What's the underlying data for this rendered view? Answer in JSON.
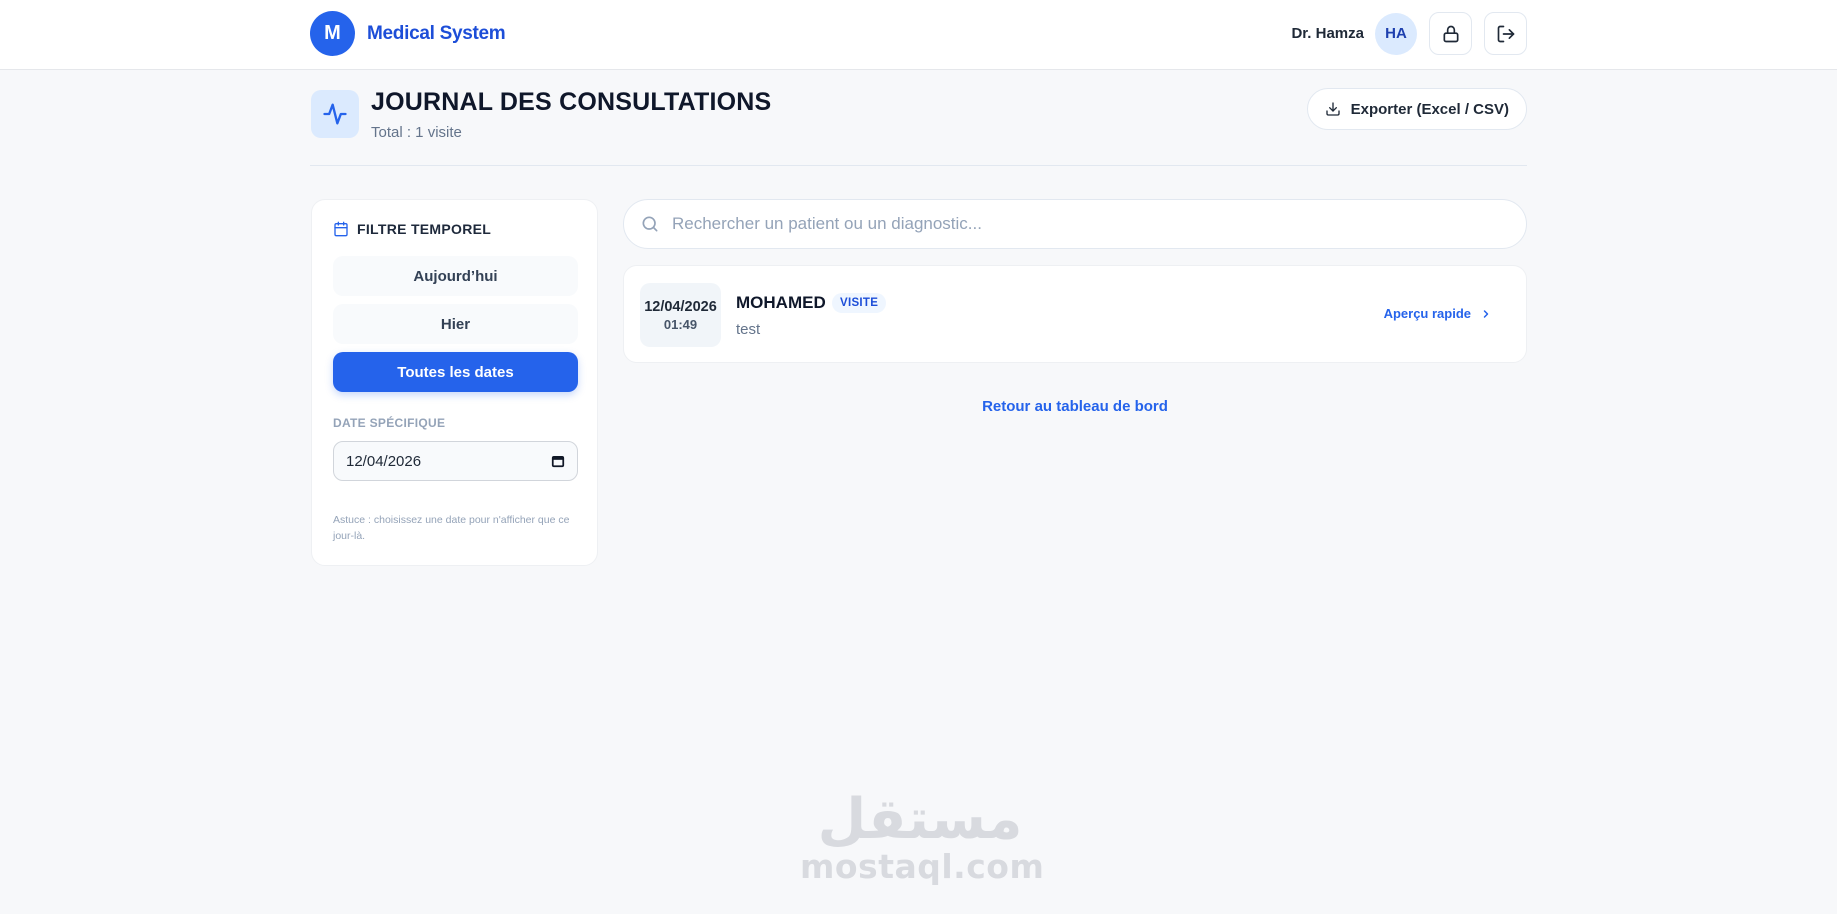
{
  "brand": {
    "logo_letter": "M",
    "name": "Medical System"
  },
  "user": {
    "name": "Dr. Hamza",
    "initials": "HA"
  },
  "header": {
    "title": "JOURNAL DES CONSULTATIONS",
    "subtitle": "Total : 1 visite",
    "export_label": "Exporter (Excel / CSV)"
  },
  "filter": {
    "title": "FILTRE TEMPOREL",
    "options": [
      {
        "label": "Aujourd’hui",
        "active": false
      },
      {
        "label": "Hier",
        "active": false
      },
      {
        "label": "Toutes les dates",
        "active": true
      }
    ],
    "date_label": "DATE SPÉCIFIQUE",
    "date_value": "12/04/2026",
    "tip": "Astuce : choisissez une date pour n'afficher que ce jour-là."
  },
  "search": {
    "placeholder": "Rechercher un patient ou un diagnostic..."
  },
  "visits": [
    {
      "date": "12/04/2026",
      "time": "01:49",
      "patient": "MOHAMED",
      "badge": "VISITE",
      "description": "test",
      "action": "Aperçu rapide"
    }
  ],
  "back_label": "Retour au tableau de bord",
  "watermark": {
    "arabic": "مستقل",
    "latin": "mostaql.com"
  },
  "colors": {
    "primary": "#2563eb",
    "primary_soft": "#dbeafe",
    "background": "#f7f8fa"
  }
}
